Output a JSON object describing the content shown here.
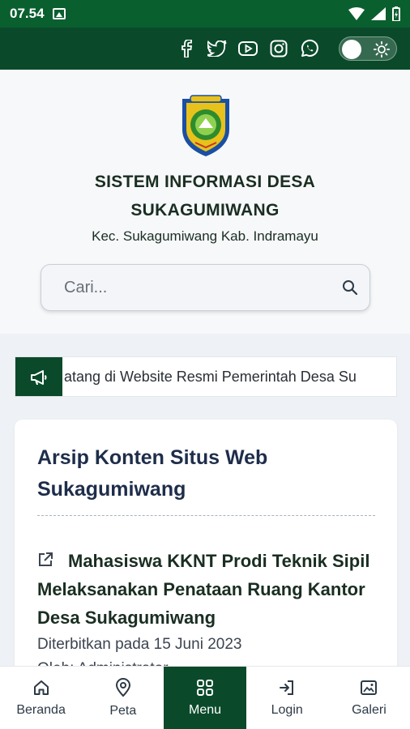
{
  "status_bar": {
    "time": "07.54"
  },
  "social": [
    "facebook-icon",
    "twitter-icon",
    "youtube-icon",
    "instagram-icon",
    "whatsapp-icon"
  ],
  "site": {
    "title_line1": "SISTEM INFORMASI DESA",
    "title_line2": "SUKAGUMIWANG",
    "subtitle": "Kec. Sukagumiwang Kab. Indramayu"
  },
  "search": {
    "placeholder": "Cari..."
  },
  "ticker": {
    "text": "atang di Website Resmi Pemerintah Desa Su"
  },
  "card": {
    "title": "Arsip Konten Situs Web Sukagumiwang",
    "article": {
      "title": "Mahasiswa KKNT Prodi Teknik Sipil Melaksanakan Penataan Ruang Kantor Desa Sukagumiwang",
      "date": "Diterbitkan pada 15 Juni 2023",
      "author": "Oleh: Administrator"
    }
  },
  "bottom_nav": [
    {
      "label": "Beranda",
      "icon": "home-icon"
    },
    {
      "label": "Peta",
      "icon": "map-pin-icon"
    },
    {
      "label": "Menu",
      "icon": "grid-icon",
      "active": true
    },
    {
      "label": "Login",
      "icon": "login-icon"
    },
    {
      "label": "Galeri",
      "icon": "gallery-icon"
    }
  ],
  "colors": {
    "primary": "#0a4a2a",
    "status": "#0a5f2f",
    "title": "#1e2d4a"
  }
}
